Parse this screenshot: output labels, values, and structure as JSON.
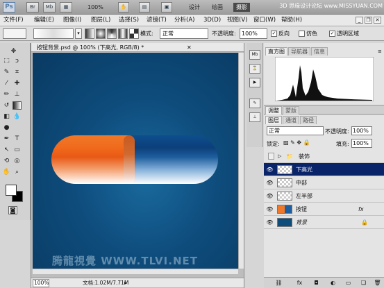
{
  "appbar": {
    "logo": "Ps",
    "br": "Br",
    "mb": "Mb",
    "zoom": "100%",
    "workspaces": [
      "设计",
      "绘画",
      "摄影"
    ],
    "active_ws": "摄影",
    "site": "3D  思缘设计论坛 www.MISSYUAN.COM"
  },
  "menu": [
    "文件(F)",
    "编辑(E)",
    "图像(I)",
    "图层(L)",
    "选择(S)",
    "滤镜(T)",
    "分析(A)",
    "3D(D)",
    "视图(V)",
    "窗口(W)",
    "帮助(H)"
  ],
  "options": {
    "mode_label": "模式:",
    "mode_value": "正常",
    "opacity_label": "不透明度:",
    "opacity_value": "100%",
    "reverse": "反向",
    "dither": "仿色",
    "transparency": "透明区域"
  },
  "document": {
    "tab_title": "按钮背景.psd @ 100% (下高光, RGB/8) *",
    "zoom": "100%",
    "status": "文档:1.02M/7.71M",
    "watermark": "腾龍視覺 WWW.TLVI.NET"
  },
  "panels": {
    "histogram_tabs": [
      "直方图",
      "导航器",
      "信息"
    ],
    "adjust_tabs": [
      "调整",
      "蒙版"
    ],
    "layers_tabs": [
      "图层",
      "通道",
      "路径"
    ]
  },
  "layers": {
    "blend_mode": "正常",
    "opacity_label": "不透明度:",
    "opacity_value": "100%",
    "lock_label": "锁定:",
    "fill_label": "填充:",
    "fill_value": "100%",
    "items": [
      {
        "name": "装饰",
        "type": "group"
      },
      {
        "name": "下高光",
        "selected": true
      },
      {
        "name": "中部"
      },
      {
        "name": "左半部"
      },
      {
        "name": "按钮",
        "fx": "fx"
      },
      {
        "name": "背景",
        "locked": true
      }
    ]
  }
}
